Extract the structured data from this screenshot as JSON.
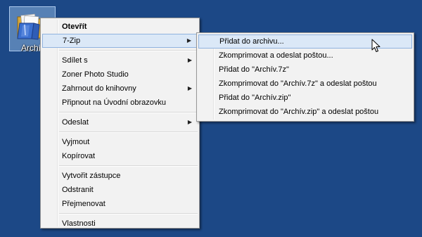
{
  "desktop": {
    "icon_label": "Archív",
    "icon_name": "folder-icon",
    "background_color": "#1c4886"
  },
  "context_menu": {
    "items": [
      {
        "label": "Otevřít",
        "bold": true
      },
      {
        "label": "7-Zip",
        "submenu": true,
        "highlighted": true
      },
      {
        "label": "Sdílet s",
        "submenu": true
      },
      {
        "label": "Zoner Photo Studio"
      },
      {
        "label": "Zahrnout do knihovny",
        "submenu": true
      },
      {
        "label": "Připnout na Úvodní obrazovku"
      },
      {
        "label": "Odeslat",
        "submenu": true
      },
      {
        "label": "Vyjmout"
      },
      {
        "label": "Kopírovat"
      },
      {
        "label": "Vytvořit zástupce"
      },
      {
        "label": "Odstranit"
      },
      {
        "label": "Přejmenovat"
      },
      {
        "label": "Vlastnosti"
      }
    ],
    "submenu_arrow": "▶"
  },
  "submenu_7zip": {
    "items": [
      {
        "label": "Přidat do archivu...",
        "highlighted": true
      },
      {
        "label": "Zkomprimovat a odeslat poštou..."
      },
      {
        "label": "Přidat do \"Archív.7z\""
      },
      {
        "label": "Zkomprimovat do \"Archív.7z\" a odeslat poštou"
      },
      {
        "label": "Přidat do \"Archív.zip\""
      },
      {
        "label": "Zkomprimovat do \"Archív.zip\" a odeslat poštou"
      }
    ]
  },
  "cursor": {
    "icon_name": "arrow-cursor-icon"
  }
}
